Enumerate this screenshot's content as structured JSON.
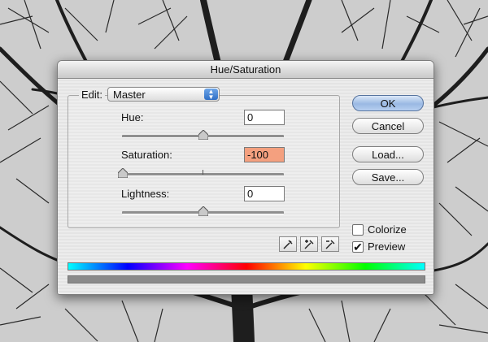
{
  "dialog": {
    "title": "Hue/Saturation",
    "edit_label": "Edit:",
    "edit_value": "Master",
    "hue": {
      "label": "Hue:",
      "value": "0"
    },
    "saturation": {
      "label": "Saturation:",
      "value": "-100"
    },
    "lightness": {
      "label": "Lightness:",
      "value": "0"
    },
    "buttons": {
      "ok": "OK",
      "cancel": "Cancel",
      "load": "Load...",
      "save": "Save..."
    },
    "options": {
      "colorize": {
        "label": "Colorize",
        "checked": false
      },
      "preview": {
        "label": "Preview",
        "checked": true
      }
    },
    "eyedroppers": [
      "eyedropper-icon",
      "eyedropper-plus-icon",
      "eyedropper-minus-icon"
    ],
    "colors": {
      "saturation_highlight": "#f4a07f",
      "default_button": "#9ab9e3"
    }
  }
}
